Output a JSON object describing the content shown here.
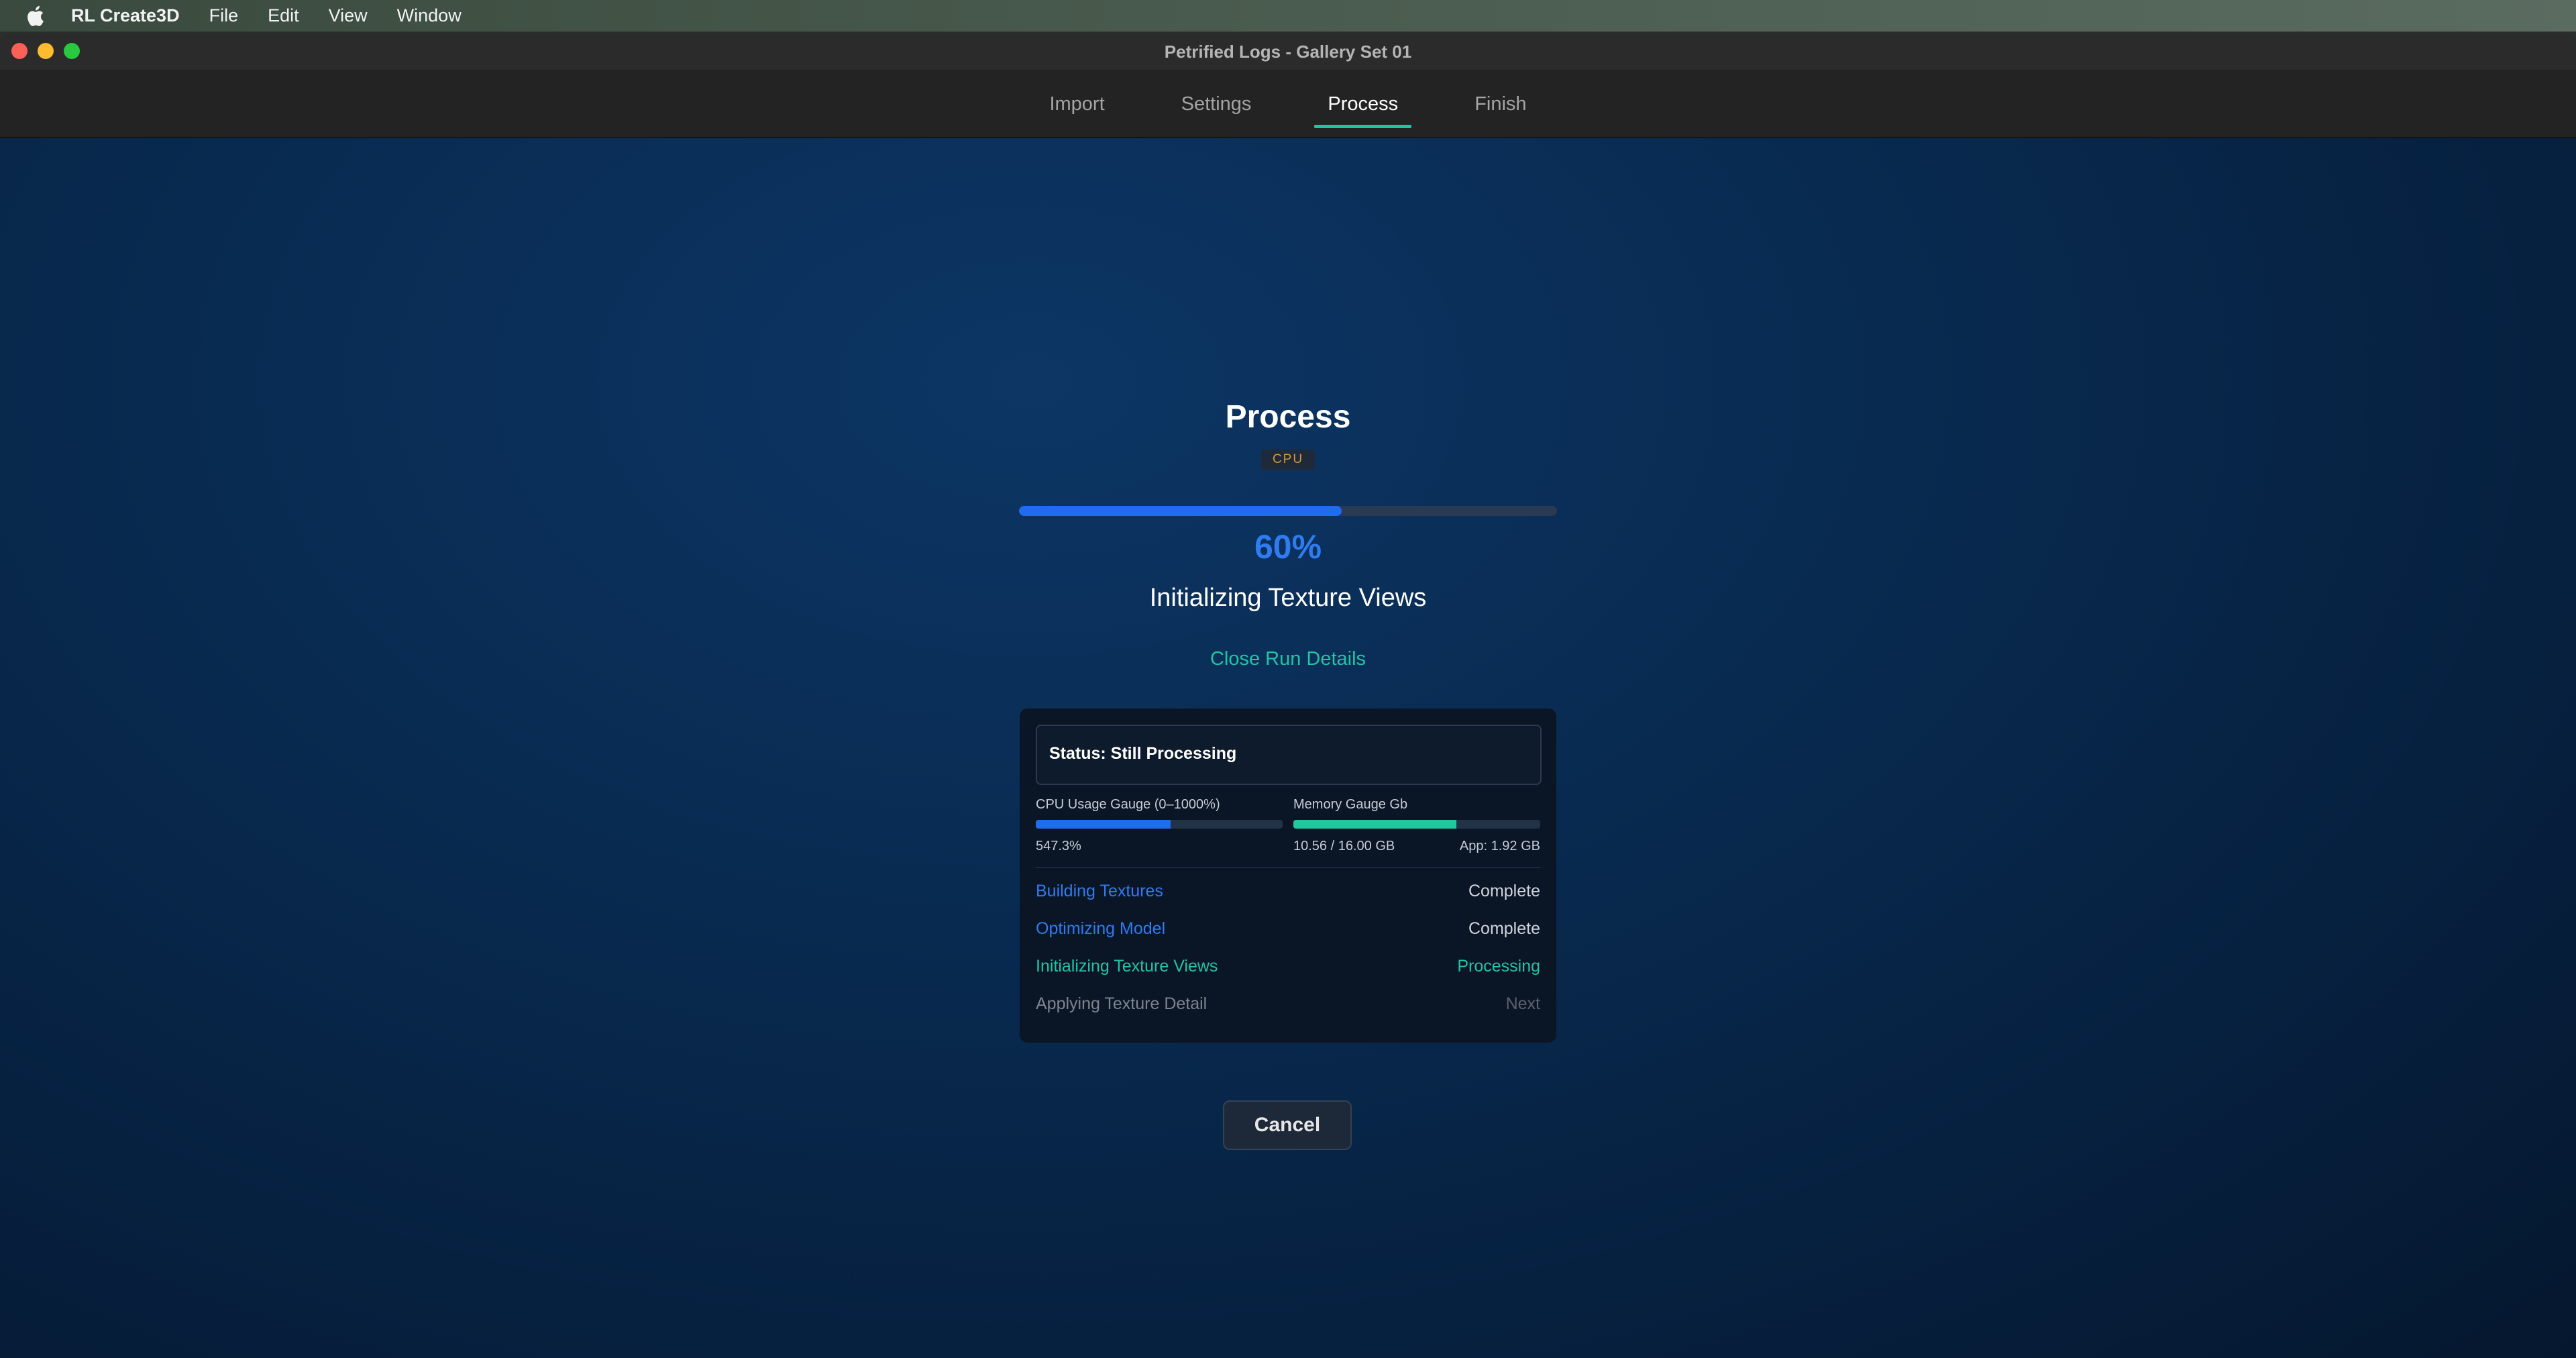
{
  "menubar": {
    "app_name": "RL Create3D",
    "items": [
      "File",
      "Edit",
      "View",
      "Window"
    ]
  },
  "window": {
    "title": "Petrified Logs - Gallery Set 01"
  },
  "tabs": [
    {
      "label": "Import",
      "active": false
    },
    {
      "label": "Settings",
      "active": false
    },
    {
      "label": "Process",
      "active": true
    },
    {
      "label": "Finish",
      "active": false
    }
  ],
  "process": {
    "heading": "Process",
    "badge": "CPU",
    "progress_percent": 60,
    "percent_label": "60%",
    "stage": "Initializing Texture Views",
    "close_details_label": "Close Run Details"
  },
  "details": {
    "status": "Status: Still Processing",
    "cpu_gauge": {
      "label": "CPU Usage Gauge (0–1000%)",
      "value_label": "547.3%",
      "fraction": 0.547,
      "color": "#1e6cf0"
    },
    "memory_gauge": {
      "label": "Memory Gauge Gb",
      "value_label": "10.56 / 16.00 GB",
      "app_label": "App: 1.92 GB",
      "fraction": 0.66,
      "color": "#1fc9a0"
    },
    "steps": [
      {
        "name": "Building Textures",
        "state": "Complete",
        "name_color": "#2f7bf0",
        "state_color": "#d0d4da"
      },
      {
        "name": "Optimizing Model",
        "state": "Complete",
        "name_color": "#2f7bf0",
        "state_color": "#d0d4da"
      },
      {
        "name": "Initializing Texture Views",
        "state": "Processing",
        "name_color": "#21c4a3",
        "state_color": "#21c4a3"
      },
      {
        "name": "Applying Texture Detail",
        "state": "Next",
        "name_color": "#7d848f",
        "state_color": "#5b626d"
      }
    ]
  },
  "cancel_label": "Cancel"
}
